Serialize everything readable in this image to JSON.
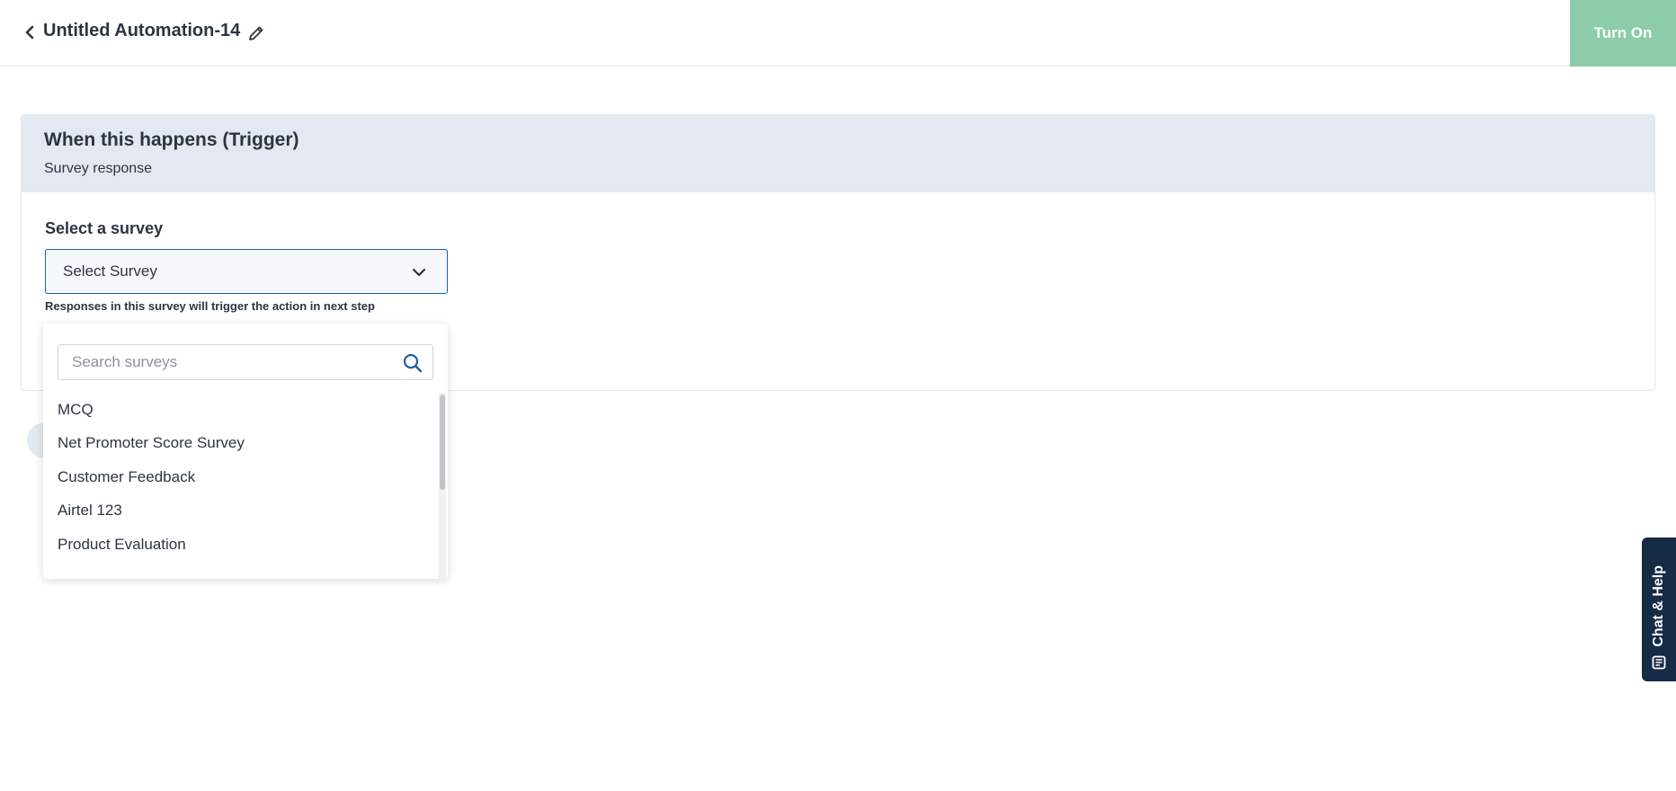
{
  "header": {
    "title": "Untitled Automation-14",
    "turn_on_label": "Turn On",
    "back_icon": "chevron-left-icon",
    "edit_icon": "pencil-icon"
  },
  "trigger": {
    "title": "When this happens (Trigger)",
    "subtitle": "Survey response",
    "field_label": "Select a survey",
    "select_value": "Select Survey",
    "helper_text": "Responses in this survey will trigger the action in next step"
  },
  "dropdown": {
    "search_placeholder": "Search surveys",
    "search_value": "",
    "items": [
      {
        "label": "MCQ"
      },
      {
        "label": "Net Promoter Score Survey"
      },
      {
        "label": "Customer Feedback"
      },
      {
        "label": "Airtel 123"
      },
      {
        "label": "Product Evaluation"
      }
    ]
  },
  "chat_help": {
    "label": "Chat & Help"
  },
  "colors": {
    "accent": "#1d5fa7",
    "turn_on_bg": "#8ccca8",
    "card_header_bg": "#e4e8f0",
    "chat_bg": "#152b46"
  }
}
